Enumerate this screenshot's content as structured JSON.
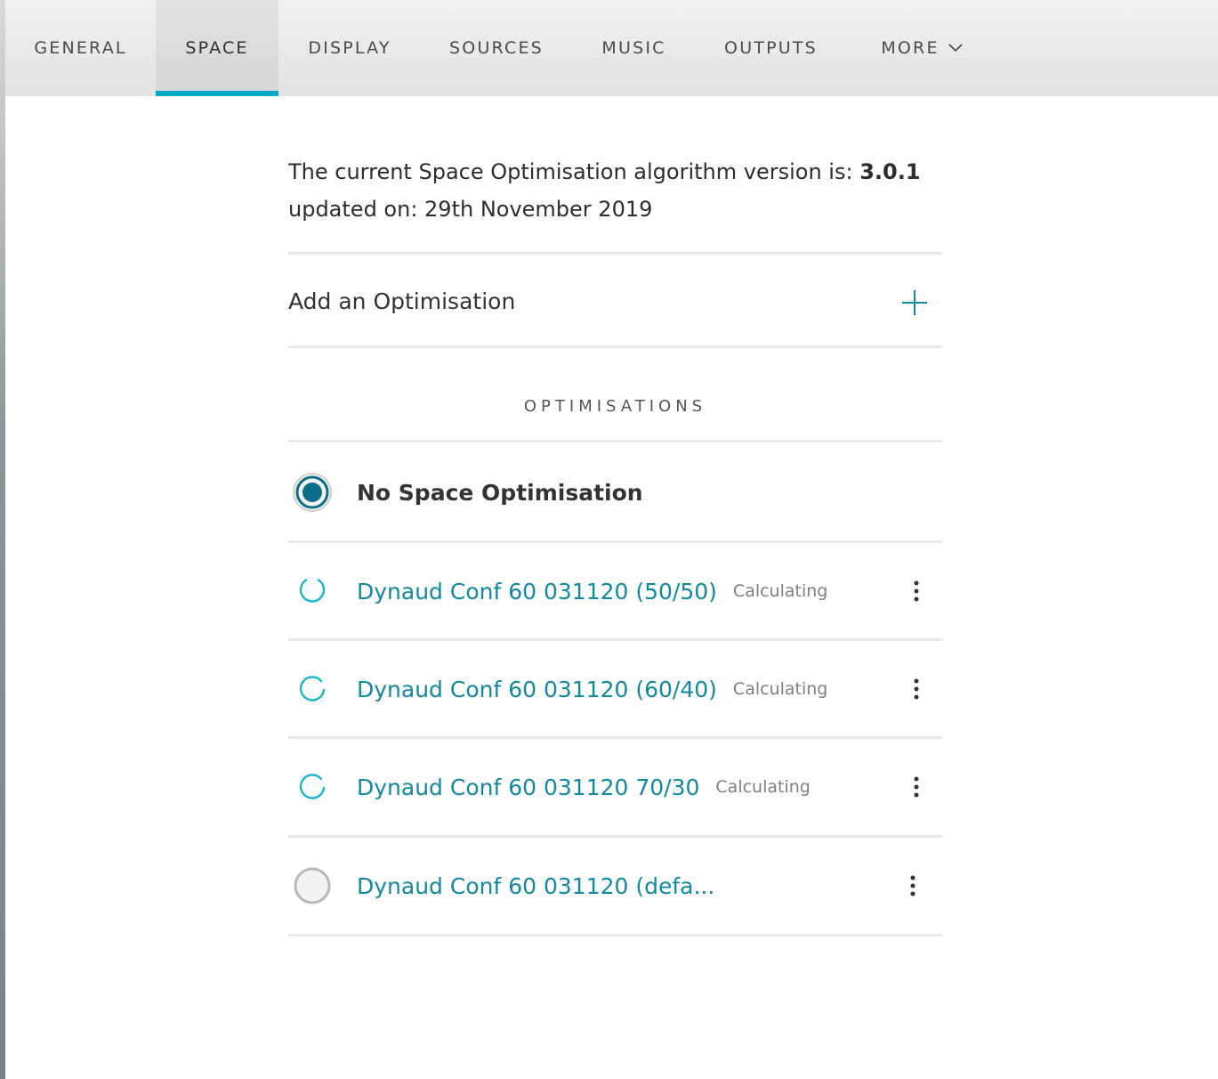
{
  "tabs": [
    {
      "label": "GENERAL",
      "active": false
    },
    {
      "label": "SPACE",
      "active": true
    },
    {
      "label": "DISPLAY",
      "active": false
    },
    {
      "label": "SOURCES",
      "active": false
    },
    {
      "label": "MUSIC",
      "active": false
    },
    {
      "label": "OUTPUTS",
      "active": false
    },
    {
      "label": "MORE",
      "active": false,
      "icon": "chevron-down-icon"
    }
  ],
  "version": {
    "prefix": "The current Space Optimisation algorithm version is: ",
    "number": "3.0.1",
    "updated": "updated on: 29th November 2019"
  },
  "add": {
    "label": "Add an Optimisation",
    "icon": "plus-icon"
  },
  "section_title": "OPTIMISATIONS",
  "optimisations": [
    {
      "name": "No Space Optimisation",
      "status": "selected",
      "badge": "",
      "menu": false
    },
    {
      "name": "Dynaud Conf 60 031120 (50/50)",
      "status": "calculating",
      "badge": "Calculating",
      "menu": true
    },
    {
      "name": "Dynaud Conf 60 031120 (60/40)",
      "status": "calculating",
      "badge": "Calculating",
      "menu": true
    },
    {
      "name": "Dynaud Conf 60 031120 70/30",
      "status": "calculating",
      "badge": "Calculating",
      "menu": true
    },
    {
      "name": "Dynaud Conf 60 031120 (defa...",
      "status": "unselected",
      "badge": "",
      "menu": true
    }
  ],
  "colors": {
    "accent": "#00a9c8",
    "link": "#12899e",
    "selected_fill": "#0a6f86"
  }
}
